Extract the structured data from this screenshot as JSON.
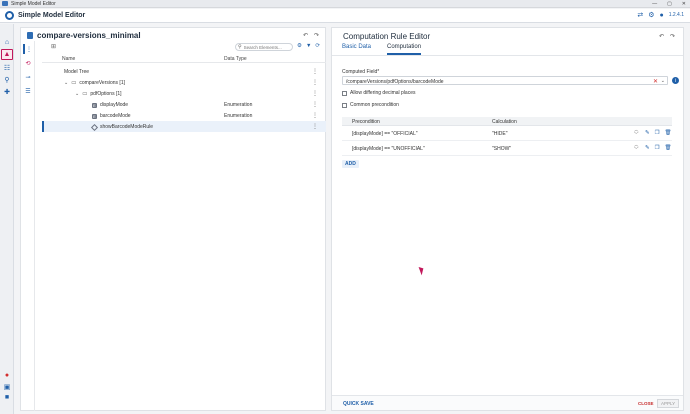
{
  "os": {
    "title": "Simple Model Editor",
    "controls": [
      "—",
      "▢",
      "✕"
    ]
  },
  "app": {
    "name": "Simple Model Editor",
    "version": "1.2.4.1",
    "icons": [
      "sync-icon",
      "gear-icon",
      "help-icon"
    ]
  },
  "rail": {
    "icons": [
      "home-icon",
      "warning-icon",
      "diagram-icon",
      "search-icon",
      "puzzle-icon"
    ],
    "bottom_icons": [
      "error-icon",
      "save-as-icon",
      "save-icon"
    ]
  },
  "tree": {
    "title": "compare-versions_minimal",
    "search_placeholder": "Search Elements...",
    "columns": {
      "name": "Name",
      "type": "Data Type"
    },
    "rows": [
      {
        "label": "Model Tree",
        "type": ""
      },
      {
        "label": "compareVersions [1]",
        "type": ""
      },
      {
        "label": "pdfOptions [1]",
        "type": ""
      },
      {
        "label": "displayMode",
        "type": "Enumeration"
      },
      {
        "label": "barcodeMode",
        "type": "Enumeration"
      },
      {
        "label": "showBarcodeModeRule",
        "type": ""
      }
    ]
  },
  "editor": {
    "title": "Computation Rule Editor",
    "tabs": [
      "Basic Data",
      "Computation"
    ],
    "computed_field_label": "Computed Field*",
    "computed_field_value": "/compareVersions/pdfOptions/barcodeMode",
    "checkbox_allow": "Allow differing decimal places",
    "checkbox_common": "Common precondition",
    "table_headers": {
      "precondition": "Precondition",
      "calculation": "Calculation"
    },
    "rules": [
      {
        "precondition": "[displayMode] == \"OFFICIAL\"",
        "calculation": "\"HIDE\""
      },
      {
        "precondition": "[displayMode] == \"UNOFFICIAL\"",
        "calculation": "\"SHOW\""
      }
    ],
    "add_label": "ADD",
    "quick_save": "QUICK SAVE",
    "close": "CLOSE",
    "apply": "APPLY"
  }
}
